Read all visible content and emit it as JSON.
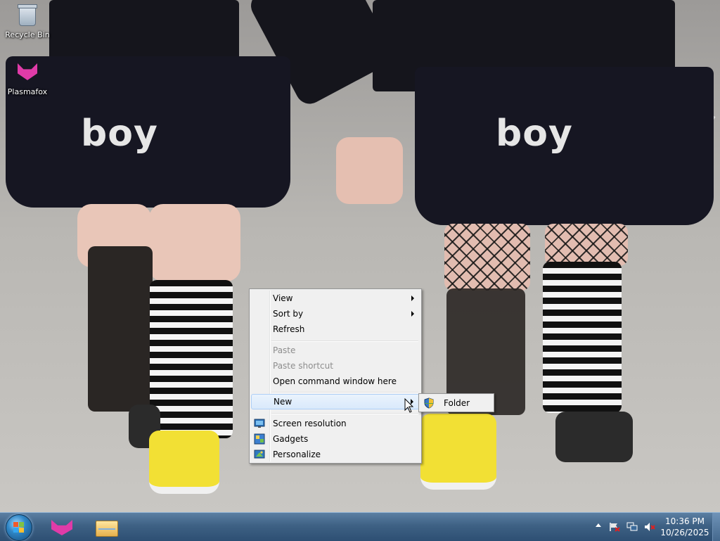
{
  "desktop": {
    "wallpaper_text": [
      "boy",
      "boy"
    ],
    "icons": [
      {
        "label": "Recycle Bin",
        "icon": "recycle-bin-icon"
      },
      {
        "label": "Plasmafox",
        "icon": "plasmafox-icon"
      }
    ]
  },
  "context_menu": {
    "items": [
      {
        "label": "View",
        "submenu": true,
        "enabled": true
      },
      {
        "label": "Sort by",
        "submenu": true,
        "enabled": true
      },
      {
        "label": "Refresh",
        "submenu": false,
        "enabled": true
      },
      {
        "label": "Paste",
        "submenu": false,
        "enabled": false
      },
      {
        "label": "Paste shortcut",
        "submenu": false,
        "enabled": false
      },
      {
        "label": "Open command window here",
        "submenu": false,
        "enabled": true
      },
      {
        "label": "New",
        "submenu": true,
        "enabled": true,
        "highlighted": true
      },
      {
        "label": "Screen resolution",
        "icon": "screen-resolution-icon",
        "enabled": true
      },
      {
        "label": "Gadgets",
        "icon": "gadgets-icon",
        "enabled": true
      },
      {
        "label": "Personalize",
        "icon": "personalize-icon",
        "enabled": true
      }
    ]
  },
  "submenu": {
    "items": [
      {
        "label": "Folder",
        "icon": "folder-shield-icon"
      }
    ]
  },
  "taskbar": {
    "pinned": [
      {
        "name": "plasmafox-taskbar-icon"
      },
      {
        "name": "windows-explorer-icon"
      }
    ],
    "tray_icons": [
      "show-hidden-icons",
      "action-center-flag-icon",
      "network-icon",
      "volume-muted-icon"
    ],
    "clock": {
      "time": "10:36 PM",
      "date": "10/26/2025"
    }
  },
  "colors": {
    "taskbar": "#3e6184",
    "menu_background": "#f0f0f0",
    "menu_highlight": "#d9e9fb",
    "disabled_text": "#8d8d8d"
  }
}
